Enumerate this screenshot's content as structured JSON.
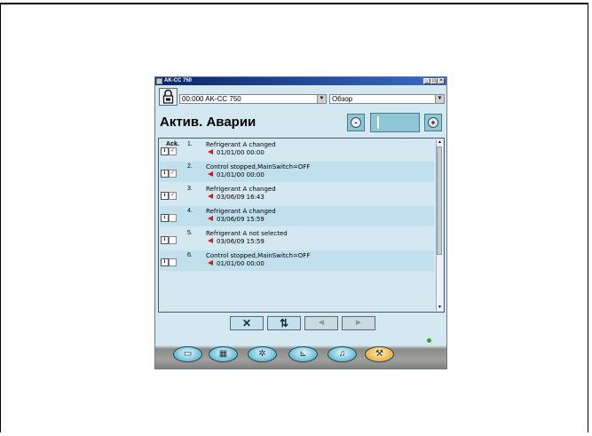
{
  "window": {
    "title": "AK-CC 750",
    "controls": [
      "_",
      "□",
      "×"
    ]
  },
  "toolbar": {
    "lock_icon": "lock-icon",
    "device_select": "00:000 AK-CC 750",
    "view_select": "Обзор"
  },
  "header": {
    "title": "Актив. Аварии",
    "prev_label": "-",
    "next_label": "+"
  },
  "alarm_list": {
    "ack_header": "Ack.",
    "rows": [
      {
        "num": "1.",
        "message": "Refrigerant A changed",
        "timestamp": "01/01/00 00:00",
        "acked": true
      },
      {
        "num": "2.",
        "message": "Control stopped,MainSwitch=OFF",
        "timestamp": "01/01/00 00:00",
        "acked": true
      },
      {
        "num": "3.",
        "message": "Refrigerant A changed",
        "timestamp": "03/06/09 16:43",
        "acked": true
      },
      {
        "num": "4.",
        "message": "Refrigerant A changed",
        "timestamp": "03/06/09 15:59",
        "acked": false
      },
      {
        "num": "5.",
        "message": "Refrigerant A not selected",
        "timestamp": "03/06/09 15:59",
        "acked": false
      },
      {
        "num": "6.",
        "message": "Control stopped,MainSwitch=OFF",
        "timestamp": "01/01/00 00:00",
        "acked": false
      }
    ]
  },
  "actions": {
    "delete": "✕",
    "refresh": "⇅",
    "back": "◄",
    "forward": "►"
  },
  "bottom_nav": [
    {
      "icon": "system-icon",
      "glyph": "▭"
    },
    {
      "icon": "grid-icon",
      "glyph": "▦"
    },
    {
      "icon": "fan-icon",
      "glyph": "✲"
    },
    {
      "icon": "graph-icon",
      "glyph": "⊾"
    },
    {
      "icon": "alarm-bell-icon",
      "glyph": "♫"
    },
    {
      "icon": "wrench-icon",
      "glyph": "⚒"
    }
  ],
  "colors": {
    "accent": "#8ec6d6",
    "alarm_flag": "#e01818",
    "status_ok": "#2ea82e",
    "active_tab": "#f0b040"
  }
}
